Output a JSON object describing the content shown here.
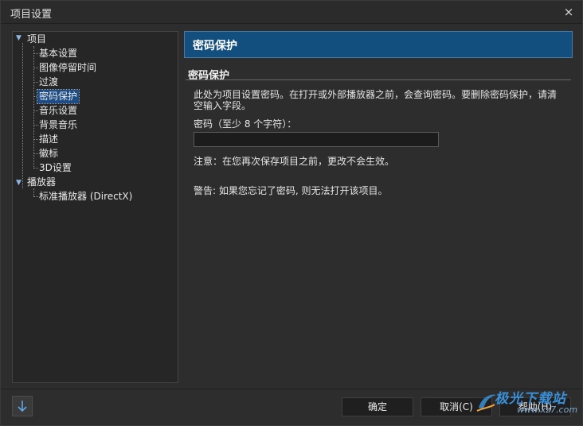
{
  "window": {
    "title": "项目设置",
    "close_glyph": "×"
  },
  "tree": {
    "root_project": "项目",
    "project_children": [
      "基本设置",
      "图像停留时间",
      "过渡",
      "密码保护",
      "音乐设置",
      "背景音乐",
      "描述",
      "徽标",
      "3D设置"
    ],
    "selected": "密码保护",
    "root_player": "播放器",
    "player_children": [
      "标准播放器 (DirectX)"
    ]
  },
  "panel": {
    "header": "密码保护",
    "section_title": "密码保护",
    "description": "此处为项目设置密码。在打开或外部播放器之前，会查询密码。要删除密码保护，请清空输入字段。",
    "password_label": "密码（至少 8 个字符）：",
    "password_value": "",
    "note": "注意：在您再次保存项目之前，更改不会生效。",
    "warning": "警告: 如果您忘记了密码, 则无法打开该项目。"
  },
  "footer": {
    "ok": "确定",
    "cancel": "取消(C)",
    "help": "帮助(H)",
    "down_icon": "down-arrow-icon"
  },
  "watermark": {
    "text": "极光下载站",
    "url": "www.xz7.com"
  },
  "colors": {
    "header_bg": "#124f7e",
    "selected_bg": "#1c4d86",
    "window_bg": "#2d2d2d"
  }
}
